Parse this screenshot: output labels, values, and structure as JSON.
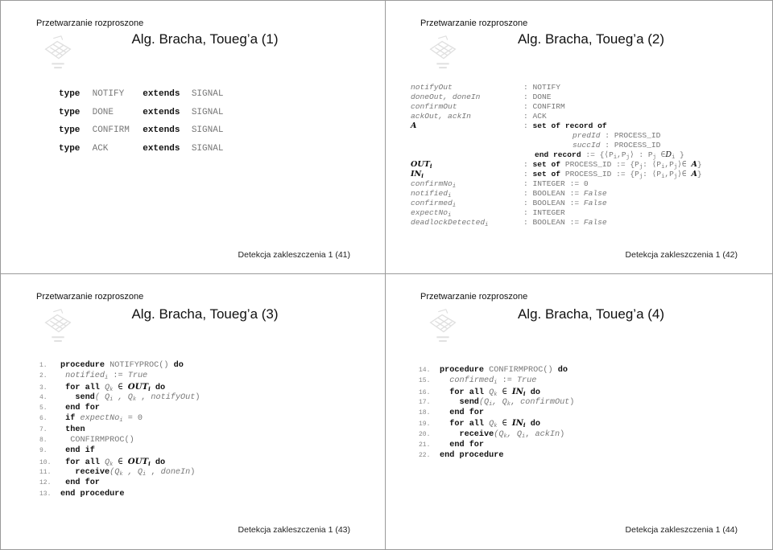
{
  "slides": [
    {
      "header": "Przetwarzanie rozproszone",
      "title": "Alg. Bracha, Toueg’a (1)",
      "footer": "Detekcja zakleszczenia 1 (41)",
      "types": [
        {
          "kw1": "type",
          "name": "NOTIFY",
          "kw2": "extends",
          "base": "SIGNAL"
        },
        {
          "kw1": "type",
          "name": "DONE",
          "kw2": "extends",
          "base": "SIGNAL"
        },
        {
          "kw1": "type",
          "name": "CONFIRM",
          "kw2": "extends",
          "base": "SIGNAL"
        },
        {
          "kw1": "type",
          "name": "ACK",
          "kw2": "extends",
          "base": "SIGNAL"
        }
      ]
    },
    {
      "header": "Przetwarzanie rozproszone",
      "title": "Alg. Bracha, Toueg’a (2)",
      "footer": "Detekcja zakleszczenia 1 (42)",
      "decls": {
        "notifyOut": {
          "lhs": "notifyOut",
          "rhs": ": NOTIFY"
        },
        "done": {
          "lhs": "doneOut, doneIn",
          "rhs": ": DONE"
        },
        "confirmOut": {
          "lhs": "confirmOut",
          "rhs": ": CONFIRM"
        },
        "ack": {
          "lhs": "ackOut, ackIn",
          "rhs": ": ACK"
        },
        "A": {
          "lhs": "A",
          "colon": ": ",
          "kw": "set of record of"
        },
        "predId": {
          "name": "predId",
          "type": " : PROCESS_ID"
        },
        "succId": {
          "name": "succId",
          "type": " : PROCESS_ID"
        },
        "endRecord": {
          "kw": "end record",
          "rest": " := {⟨P",
          "s1": "i",
          "mid": ",P",
          "s2": "j",
          "mid2": "⟩ : P",
          "s3": "j",
          "tail": " ∈",
          "D": "D",
          "s4": "i",
          "close": " }"
        },
        "OUT": {
          "lhs": "OUT",
          "sub": "i",
          "colon": ": ",
          "kw": "set of",
          "rest": " PROCESS_ID := {P",
          "s1": "j",
          "mid": ": ⟨P",
          "s2": "i",
          "mid2": ",P",
          "s3": "j",
          "tail": "⟩∈ ",
          "A": "A",
          "close": "}"
        },
        "IN": {
          "lhs": "IN",
          "sub": "i",
          "colon": ": ",
          "kw": "set of",
          "rest": " PROCESS_ID := {P",
          "s1": "j",
          "mid": ": ⟨P",
          "s2": "i",
          "mid2": ",P",
          "s3": "j",
          "tail": "⟩∈ ",
          "A": "A",
          "close": "}"
        },
        "confirmNo": {
          "lhs": "confirmNo",
          "sub": "i",
          "rhs": ": INTEGER := 0"
        },
        "notified": {
          "lhs": "notified",
          "sub": "i",
          "rhs": ": BOOLEAN := ",
          "val": "False"
        },
        "confirmed": {
          "lhs": "confirmed",
          "sub": "i",
          "rhs": ": BOOLEAN := ",
          "val": "False"
        },
        "expectNo": {
          "lhs": "expectNo",
          "sub": "i",
          "rhs": ": INTEGER"
        },
        "deadlockDetected": {
          "lhs": "deadlockDetected",
          "sub": "i",
          "rhs": ": BOOLEAN := ",
          "val": "False"
        }
      }
    },
    {
      "header": "Przetwarzanie rozproszone",
      "title": "Alg. Bracha, Toueg’a (3)",
      "footer": "Detekcja zakleszczenia 1 (43)",
      "lines": [
        "1.",
        "2.",
        "3.",
        "4.",
        "5.",
        "6.",
        "7.",
        "8.",
        "9.",
        "10.",
        "11.",
        "12.",
        "13."
      ],
      "code": {
        "l1": {
          "kw": "procedure",
          "name": " NOTIFYPROC()",
          "kw2": " do"
        },
        "l2": {
          "var": "notified",
          "sub": "i",
          "rest": " := ",
          "val": "True"
        },
        "l3": {
          "kw": "for all",
          "q": " Q",
          "qs": "k",
          "in": " ∈ ",
          "set": "OUT",
          "ss": "i",
          "kw2": " do"
        },
        "l4": {
          "kw": "send",
          "rest": "( Q",
          "s1": "i",
          "mid": " , Q",
          "s2": "k",
          "mid2": " , ",
          "arg": "notifyOut",
          "close": ")"
        },
        "l5": {
          "kw": "end for"
        },
        "l6": {
          "kw": "if",
          "var": " expectNo",
          "sub": "i",
          "rest": " = 0"
        },
        "l7": {
          "kw": "then"
        },
        "l8": {
          "call": "CONFIRMPROC()"
        },
        "l9": {
          "kw": "end if"
        },
        "l10": {
          "kw": "for all",
          "q": " Q",
          "qs": "k",
          "in": " ∈ ",
          "set": "OUT",
          "ss": "i",
          "kw2": " do"
        },
        "l11": {
          "kw": "receive",
          "rest": "(Q",
          "s1": "k",
          "mid": " , Q",
          "s2": "i",
          "mid2": " , ",
          "arg": "doneIn",
          "close": ")"
        },
        "l12": {
          "kw": "end for"
        },
        "l13": {
          "kw": "end procedure"
        }
      }
    },
    {
      "header": "Przetwarzanie rozproszone",
      "title": "Alg. Bracha, Toueg’a (4)",
      "footer": "Detekcja zakleszczenia 1 (44)",
      "lines": [
        "14.",
        "15.",
        "16.",
        "17.",
        "18.",
        "19.",
        "20.",
        "21.",
        "22."
      ],
      "code": {
        "l14": {
          "kw": "procedure",
          "name": " CONFIRMPROC()",
          "kw2": " do"
        },
        "l15": {
          "var": "confirmed",
          "sub": "i",
          "rest": " := ",
          "val": "True"
        },
        "l16": {
          "kw": "for all",
          "q": " Q",
          "qs": "k",
          "in": " ∈ ",
          "set": "IN",
          "ss": "i",
          "kw2": " do"
        },
        "l17": {
          "kw": "send",
          "rest": "(Q",
          "s1": "i",
          "mid": ", Q",
          "s2": "k",
          "mid2": ", ",
          "arg": "confirmOut",
          "close": ")"
        },
        "l18": {
          "kw": "end for"
        },
        "l19": {
          "kw": "for all",
          "q": " Q",
          "qs": "k",
          "in": " ∈ ",
          "set": "IN",
          "ss": "i",
          "kw2": " do"
        },
        "l20": {
          "kw": "receive",
          "rest": "(Q",
          "s1": "k",
          "mid": ", Q",
          "s2": "i",
          "mid2": ", ",
          "arg": "ackIn",
          "close": ")"
        },
        "l21": {
          "kw": "end for"
        },
        "l22": {
          "kw": "end procedure"
        }
      }
    }
  ]
}
